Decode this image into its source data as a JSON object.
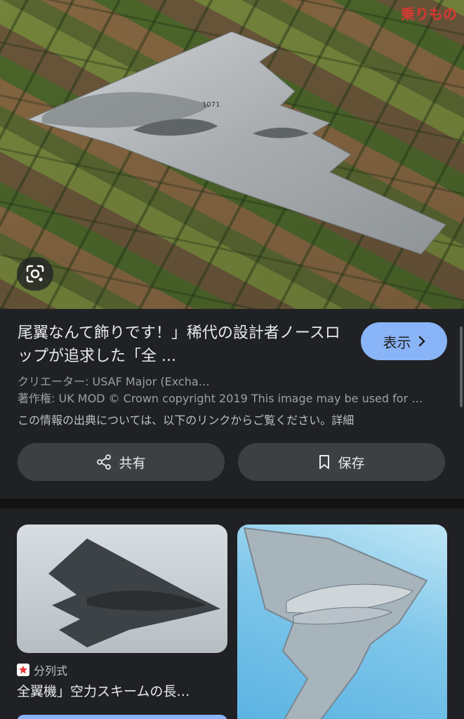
{
  "hero": {
    "brand_mark": "乗りもの",
    "lens_icon": "google-lens-icon",
    "aircraft_marking": "1071"
  },
  "info": {
    "title": "尾翼なんて飾りです！」稀代の設計者ノースロップが追求した「全 ...",
    "visit_label": "表示",
    "creator": "クリエーター: USAF Major (Excha…",
    "copyright": "著作権: UK MOD © Crown copyright 2019 This image may be used for …",
    "source_note": "この情報の出典については、以下のリンクからご覧ください。詳細",
    "share_label": "共有",
    "save_label": "保存"
  },
  "related": [
    {
      "source": "分列式",
      "title": "全翼機」空力スキームの長…"
    }
  ],
  "colors": {
    "background": "#202124",
    "accent": "#8ab4f8",
    "button_bg": "#3c4043"
  }
}
